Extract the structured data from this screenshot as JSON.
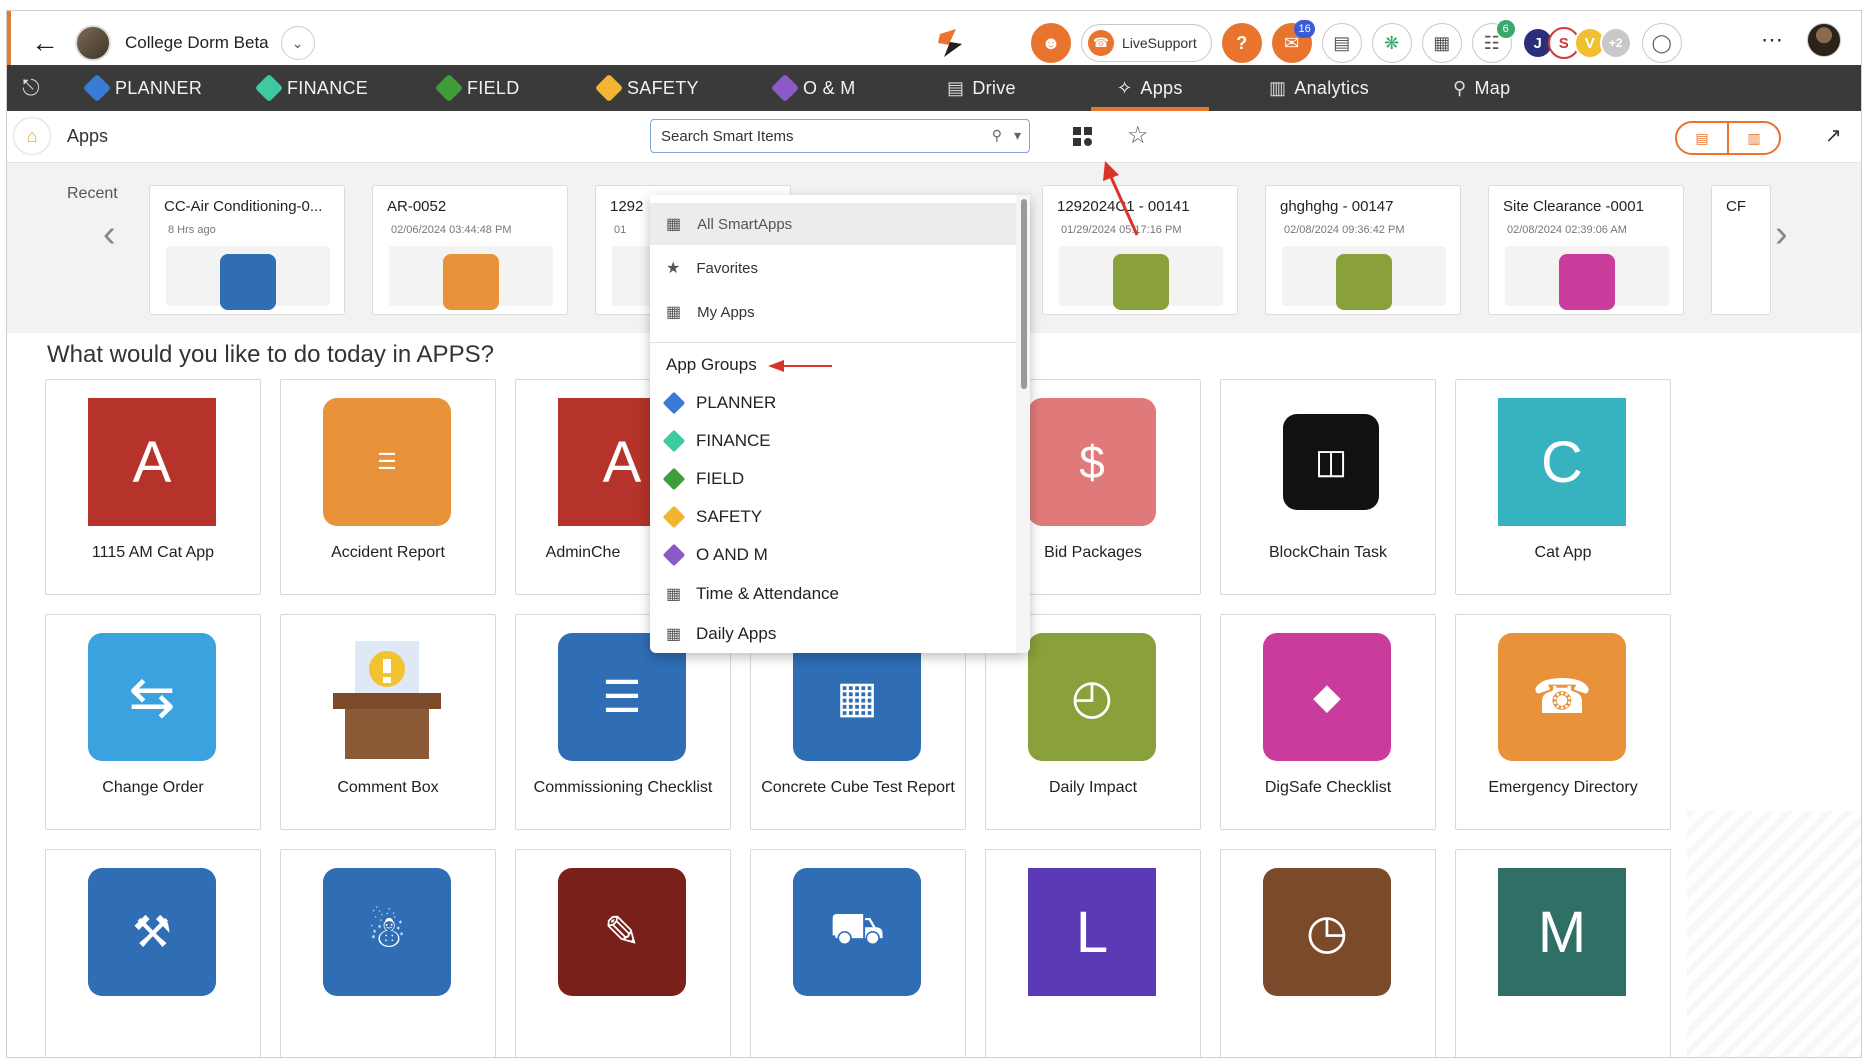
{
  "topbar": {
    "project_name": "College Dorm Beta",
    "livesupport_label": "LiveSupport",
    "notif_count": "16",
    "cart_badge": "6",
    "avatars": [
      {
        "letter": "J",
        "color": "#2b2f7a"
      },
      {
        "letter": "S",
        "color": "#ffffff",
        "text_color": "#d23a3a"
      },
      {
        "letter": "V",
        "color": "#f0c030"
      },
      {
        "letter": "+2",
        "color": "#c8c8c8"
      }
    ]
  },
  "nav": {
    "items": [
      {
        "label": "PLANNER",
        "color": "#3a7bd5"
      },
      {
        "label": "FINANCE",
        "color": "#3fc9a0"
      },
      {
        "label": "FIELD",
        "color": "#3f9e3a"
      },
      {
        "label": "SAFETY",
        "color": "#f2b531"
      },
      {
        "label": "O & M",
        "color": "#8a5ac6"
      },
      {
        "label": "Drive",
        "color": ""
      },
      {
        "label": "Apps",
        "color": ""
      },
      {
        "label": "Analytics",
        "color": ""
      },
      {
        "label": "Map",
        "color": ""
      }
    ],
    "active": "Apps"
  },
  "subheader": {
    "title": "Apps",
    "search_placeholder": "Search Smart Items"
  },
  "recent": {
    "label": "Recent",
    "cards": [
      {
        "title": "CC-Air Conditioning-0...",
        "date": "8 Hrs ago",
        "icon_color": "#2f6db5"
      },
      {
        "title": "AR-0052",
        "date": "02/06/2024 03:44:48 PM",
        "icon_color": "#e8923a"
      },
      {
        "title": "1292",
        "date": "01",
        "icon_color": "#888888"
      },
      {
        "title": "1292024C1 - 00141",
        "date": "01/29/2024 05:17:16 PM",
        "icon_color": "#8aa03a"
      },
      {
        "title": "ghghghg - 00147",
        "date": "02/08/2024 09:36:42 PM",
        "icon_color": "#8aa03a"
      },
      {
        "title": "Site Clearance -0001",
        "date": "02/08/2024 02:39:06 AM",
        "icon_color": "#c93c9c"
      },
      {
        "title": "CF",
        "date": "",
        "icon_color": "#888888"
      }
    ]
  },
  "question": "What would you like to do today in APPS?",
  "tiles": [
    {
      "label": "1115 AM Cat App",
      "letter": "A",
      "color": "#b5332a",
      "square": true
    },
    {
      "label": "Accident Report",
      "letter": "",
      "color": "#e8923a",
      "square": false
    },
    {
      "label": "AdminChe",
      "letter": "A",
      "color": "#b5332a",
      "square": true
    },
    {
      "label": "",
      "letter": "",
      "color": "#ffffff",
      "square": true
    },
    {
      "label": "Bid Packages",
      "letter": "",
      "color": "#e07a7a",
      "square": false
    },
    {
      "label": "BlockChain Task",
      "letter": "",
      "color": "#111111",
      "square": false
    },
    {
      "label": "Cat App",
      "letter": "C",
      "color": "#36b3bf",
      "square": true
    },
    {
      "label": "Change Order",
      "letter": "",
      "color": "#3aa3df",
      "square": false
    },
    {
      "label": "Comment Box",
      "letter": "",
      "color": "#ffffff",
      "square": false
    },
    {
      "label": "Commissioning Checklist",
      "letter": "",
      "color": "#2f6db5",
      "square": false
    },
    {
      "label": "Concrete Cube Test Report",
      "letter": "",
      "color": "#2f6db5",
      "square": false
    },
    {
      "label": "Daily Impact",
      "letter": "",
      "color": "#8aa03a",
      "square": false
    },
    {
      "label": "DigSafe Checklist",
      "letter": "",
      "color": "#c93c9c",
      "square": false
    },
    {
      "label": "Emergency Directory",
      "letter": "",
      "color": "#e8923a",
      "square": false
    },
    {
      "label": "",
      "letter": "",
      "color": "#2f6db5",
      "square": false
    },
    {
      "label": "",
      "letter": "",
      "color": "#2f6db5",
      "square": false
    },
    {
      "label": "",
      "letter": "",
      "color": "#7a1f1a",
      "square": false
    },
    {
      "label": "",
      "letter": "",
      "color": "#2f6db5",
      "square": false
    },
    {
      "label": "",
      "letter": "L",
      "color": "#5a3ab5",
      "square": true
    },
    {
      "label": "",
      "letter": "",
      "color": "#7a4a2a",
      "square": false
    },
    {
      "label": "",
      "letter": "M",
      "color": "#2f6f66",
      "square": true
    }
  ],
  "dropdown": {
    "items": [
      "All SmartApps",
      "Favorites",
      "My Apps"
    ],
    "groups_heading": "App Groups",
    "groups": [
      {
        "label": "PLANNER",
        "color": "#3a7bd5"
      },
      {
        "label": "FINANCE",
        "color": "#3fc9a0"
      },
      {
        "label": "FIELD",
        "color": "#3f9e3a"
      },
      {
        "label": "SAFETY",
        "color": "#f2b531"
      },
      {
        "label": "O AND M",
        "color": "#8a5ac6"
      },
      {
        "label": "Time & Attendance",
        "color": ""
      },
      {
        "label": "Daily Apps",
        "color": ""
      }
    ]
  }
}
